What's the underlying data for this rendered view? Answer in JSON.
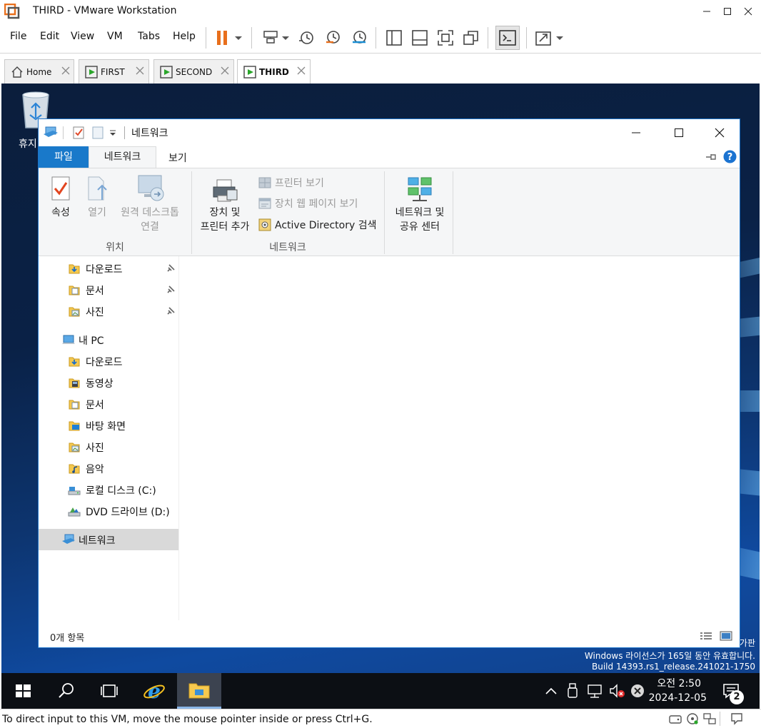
{
  "vmware": {
    "title": "THIRD - VMware Workstation",
    "menu": [
      "File",
      "Edit",
      "View",
      "VM",
      "Tabs",
      "Help"
    ],
    "tabs": [
      {
        "label": "Home",
        "icon": "home-icon"
      },
      {
        "label": "FIRST",
        "icon": "vm-icon"
      },
      {
        "label": "SECOND",
        "icon": "vm-icon"
      },
      {
        "label": "THIRD",
        "icon": "vm-icon",
        "active": true
      }
    ],
    "status_text": "To direct input to this VM, move the mouse pointer inside or press Ctrl+G.",
    "accent": "#e86f1c"
  },
  "desktop": {
    "recycle_label": "휴지",
    "watermark_edition": "가판",
    "watermark_license": "Windows 라이선스가 165일 동안 유효합니다.",
    "watermark_build": "Build 14393.rs1_release.241021-1750"
  },
  "explorer": {
    "title": "네트워크",
    "ribbon_tabs": {
      "file": "파일",
      "network": "네트워크",
      "view": "보기"
    },
    "ribbon": {
      "properties": "속성",
      "open": "열기",
      "remote_desktop_1": "원격 데스크톱",
      "remote_desktop_2": "연결",
      "group_location": "위치",
      "add_device_1": "장치 및",
      "add_device_2": "프린터 추가",
      "view_printers": "프린터 보기",
      "view_device_webpage": "장치 웹 페이지 보기",
      "search_ad": "Active Directory 검색",
      "group_network": "네트워크",
      "network_center_1": "네트워크 및",
      "network_center_2": "공유 센터"
    },
    "nav": {
      "quick_downloads": "다운로드",
      "quick_documents": "문서",
      "quick_pictures": "사진",
      "this_pc": "내 PC",
      "downloads": "다운로드",
      "videos": "동영상",
      "documents": "문서",
      "desktop": "바탕 화면",
      "pictures": "사진",
      "music": "음악",
      "local_disk": "로컬 디스크 (C:)",
      "dvd_drive": "DVD 드라이브 (D:)",
      "network": "네트워크"
    },
    "status": "0개 항목",
    "accent": "#1979ca"
  },
  "taskbar": {
    "time": "오전 2:50",
    "date": "2024-12-05",
    "notification_count": "2"
  }
}
